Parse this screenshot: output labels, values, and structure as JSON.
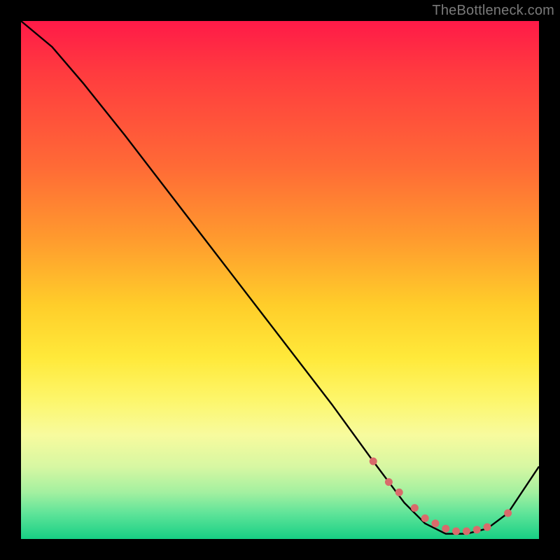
{
  "attribution": "TheBottleneck.com",
  "chart_data": {
    "type": "line",
    "title": "",
    "xlabel": "",
    "ylabel": "",
    "xlim": [
      0,
      100
    ],
    "ylim": [
      0,
      100
    ],
    "series": [
      {
        "name": "bottleneck-curve",
        "x": [
          0,
          6,
          12,
          20,
          30,
          40,
          50,
          60,
          68,
          74,
          78,
          82,
          86,
          90,
          94,
          100
        ],
        "y": [
          100,
          95,
          88,
          78,
          65,
          52,
          39,
          26,
          15,
          7,
          3,
          1,
          1,
          2,
          5,
          14
        ]
      }
    ],
    "markers": {
      "name": "highlight-cluster",
      "x": [
        68,
        71,
        73,
        76,
        78,
        80,
        82,
        84,
        86,
        88,
        90,
        94
      ],
      "y": [
        15,
        11,
        9,
        6,
        4,
        3,
        2,
        1.5,
        1.5,
        1.8,
        2.3,
        5
      ]
    },
    "gradient_stops": [
      {
        "pos": 0.0,
        "color": "#ff1a48"
      },
      {
        "pos": 0.28,
        "color": "#ff6a36"
      },
      {
        "pos": 0.55,
        "color": "#ffce2a"
      },
      {
        "pos": 0.8,
        "color": "#f7fb9e"
      },
      {
        "pos": 1.0,
        "color": "#17d084"
      }
    ],
    "marker_color": "#d96b6b",
    "curve_color": "#000000"
  }
}
